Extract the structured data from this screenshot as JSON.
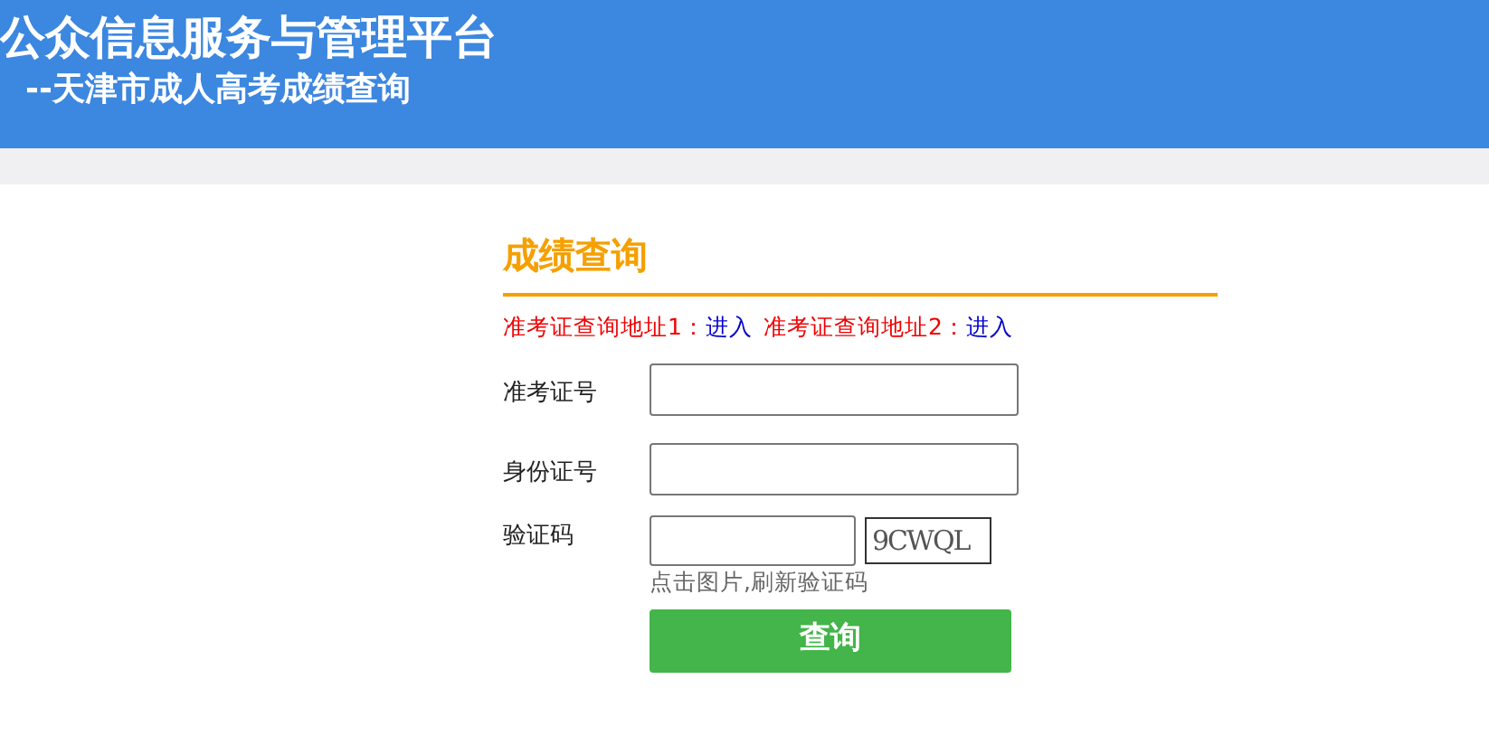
{
  "header": {
    "title": "公众信息服务与管理平台",
    "subtitle": "--天津市成人高考成绩查询"
  },
  "form": {
    "title": "成绩查询",
    "links": [
      {
        "label": "准考证查询地址1：",
        "link": "进入"
      },
      {
        "label": "准考证查询地址2：",
        "link": "进入"
      }
    ],
    "fields": [
      {
        "kind": "text",
        "label": "准考证号"
      },
      {
        "kind": "text",
        "label": "身份证号"
      },
      {
        "kind": "captcha",
        "label": "验证码",
        "captcha": "9CWQL",
        "hint": "点击图片,刷新验证码"
      }
    ],
    "submit": "查询"
  }
}
